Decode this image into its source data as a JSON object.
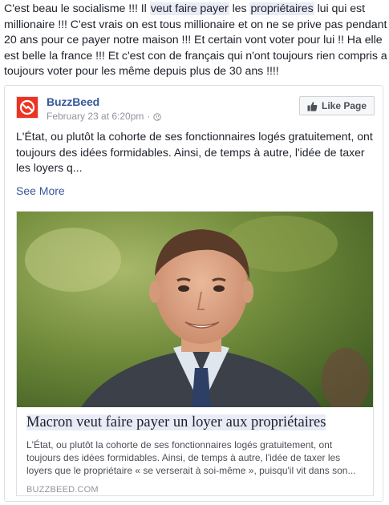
{
  "post": {
    "text_1": "C'est beau le socialisme !!! Il ",
    "hl_1": "veut faire payer",
    "text_2": " les ",
    "hl_2": "propriétaires",
    "text_3": " lui qui est millionaire !!! C'est vrais on est tous millionaire et on ne se prive pas pendant 20 ans pour ce payer notre maison !!! Et certain vont voter pour lui !! Ha elle est belle la france !!! Et c'est con de français qui n'ont toujours rien compris a toujours voter pour les même depuis plus de 30 ans !!!!"
  },
  "shared": {
    "page_name": "BuzzBeed",
    "timestamp": "February 23 at 6:20pm",
    "separator": "·",
    "privacy_icon": "globe-icon",
    "like_page_label": "Like Page",
    "description": "L'État, ou plutôt la cohorte de ses fonctionnaires logés gratuitement, ont toujours des idées formidables. Ainsi, de temps à autre, l'idée de taxer les loyers q...",
    "see_more_label": "See More",
    "brand_color": "#365899",
    "avatar_color": "#ee3322"
  },
  "link_preview": {
    "title": "Macron veut faire payer un loyer aux propriétaires",
    "description": "L'État, ou plutôt la cohorte de ses fonctionnaires logés gratuitement, ont toujours des idées formidables. Ainsi, de temps à autre, l'idée de taxer les loyers que le propriétaire « se verserait à soi-même », puisqu'il vit dans son...",
    "domain": "BUZZBEED.COM"
  }
}
